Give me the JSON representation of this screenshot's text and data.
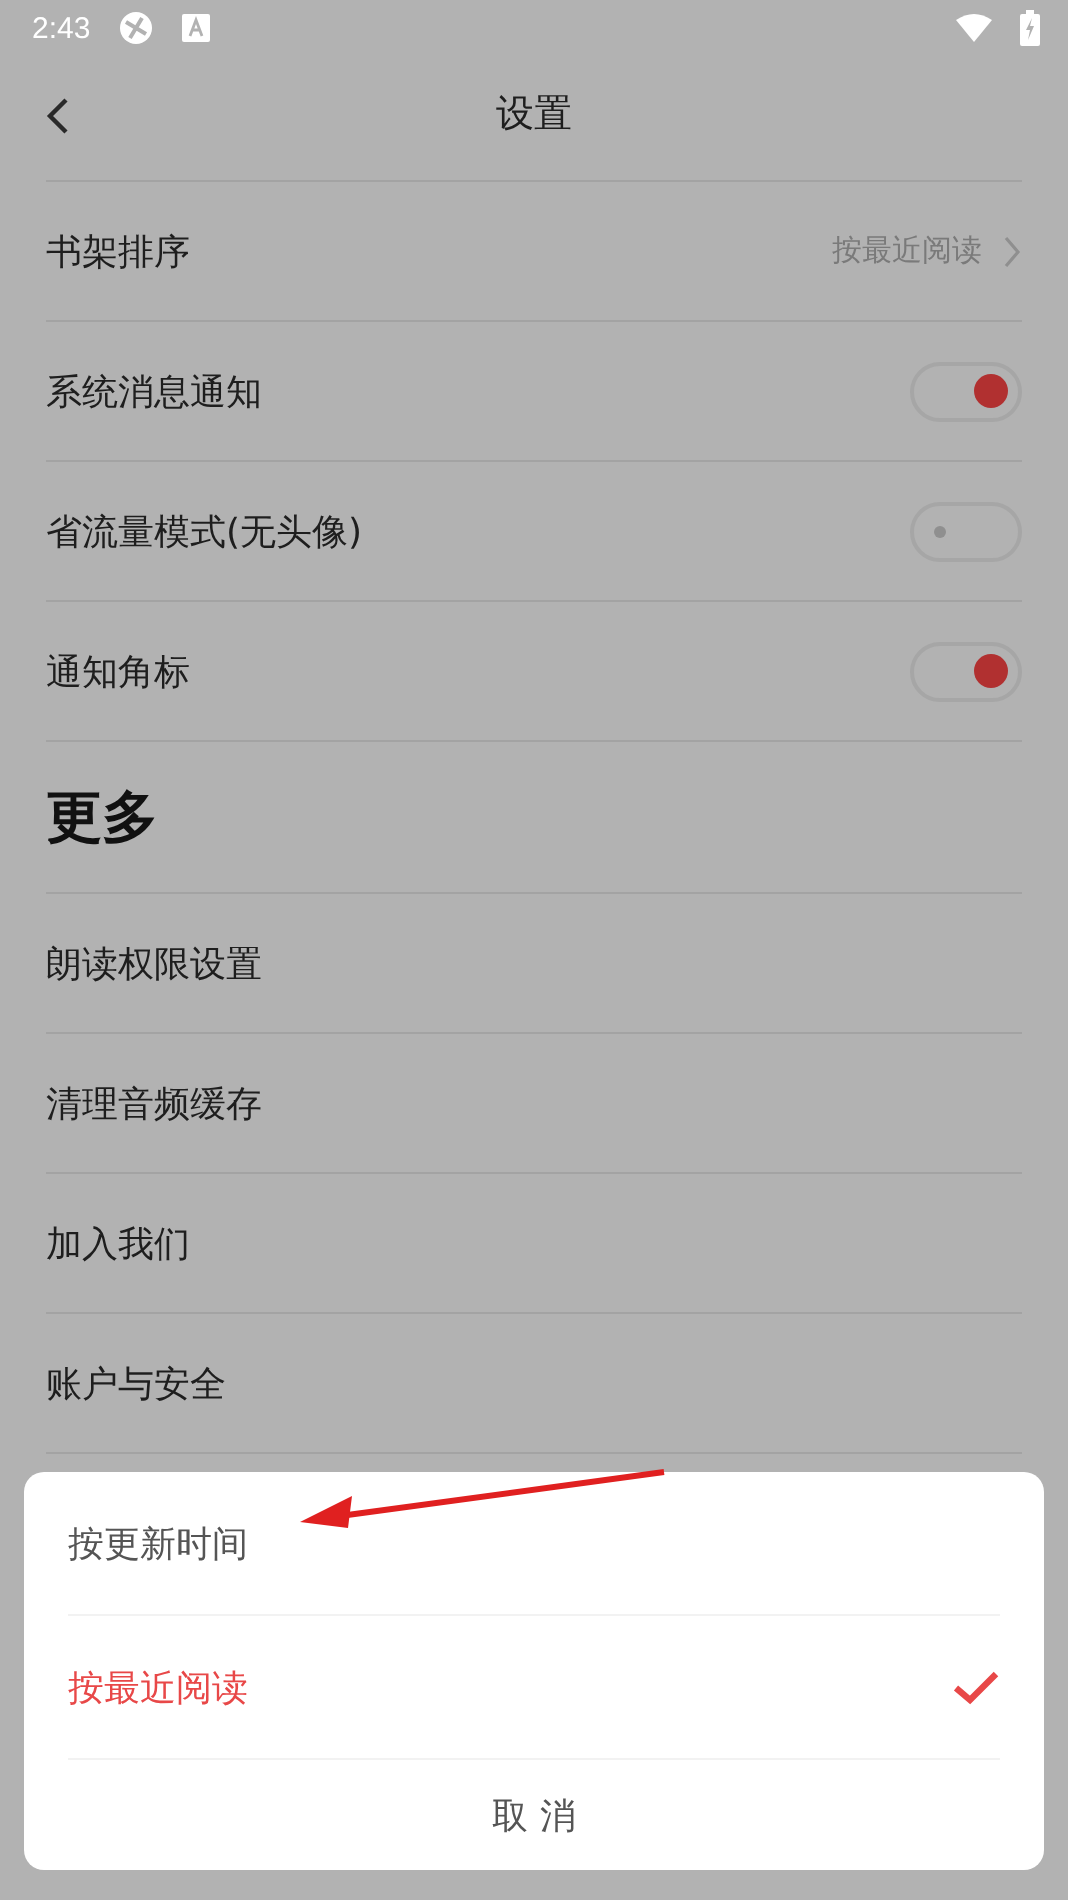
{
  "status_bar": {
    "time": "2:43"
  },
  "header": {
    "title": "设置"
  },
  "settings": [
    {
      "kind": "link",
      "label": "书架排序",
      "value": "按最近阅读"
    },
    {
      "kind": "toggle",
      "label": "系统消息通知",
      "on": true
    },
    {
      "kind": "toggle",
      "label": "省流量模式(无头像)",
      "on": false
    },
    {
      "kind": "toggle",
      "label": "通知角标",
      "on": true
    }
  ],
  "more": {
    "heading": "更多",
    "items": [
      "朗读权限设置",
      "清理音频缓存",
      "加入我们",
      "账户与安全"
    ]
  },
  "sheet": {
    "options": [
      {
        "label": "按更新时间",
        "selected": false
      },
      {
        "label": "按最近阅读",
        "selected": true
      }
    ],
    "cancel": "取消"
  }
}
